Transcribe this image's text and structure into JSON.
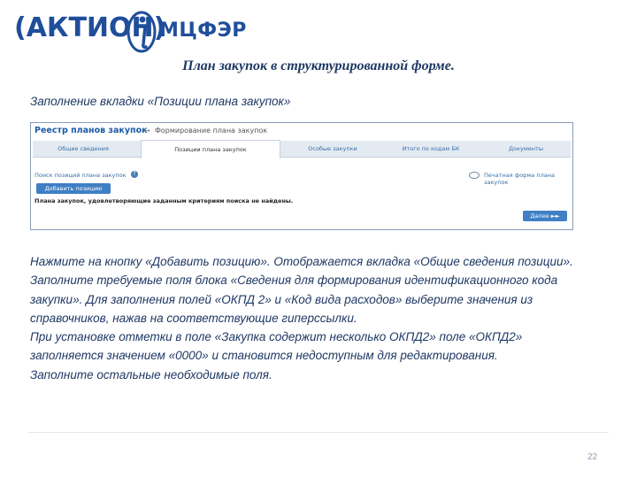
{
  "header": {
    "logo_left": "(АКТИОН)",
    "logo_right": "МЦФЭР",
    "colors": {
      "brand_blue": "#1f4e9b",
      "title_blue": "#1f3864"
    }
  },
  "slide": {
    "title": "План закупок в структурированной форме.",
    "subtitle": "Заполнение вкладки «Позиции плана закупок»"
  },
  "screenshot": {
    "breadcrumb_main": "Реестр планов закупок",
    "breadcrumb_arrow": "→",
    "breadcrumb_current": "Формирование плана закупок",
    "tabs": [
      {
        "label": "Общие сведения",
        "active": false
      },
      {
        "label": "Позиции плана закупок",
        "active": true
      },
      {
        "label": "Особые закупки",
        "active": false
      },
      {
        "label": "Итого по кодам БК",
        "active": false
      },
      {
        "label": "Документы",
        "active": false
      }
    ],
    "search_link": "Поиск позиций плана закупок",
    "print_link": "Печатная форма плана закупок",
    "add_button": "Добавить позицию",
    "notice": "Плана закупок, удовлетворяющие заданным критериям поиска не найдены.",
    "next_button": "Далее ►►"
  },
  "body": {
    "paragraphs": [
      "Нажмите на кнопку «Добавить позицию». Отображается вкладка «Общие сведения позиции». Заполните требуемые поля блока «Сведения для формирования идентификационного кода закупки». Для заполнения полей «ОКПД 2» и «Код вида расходов» выберите значения из справочников, нажав на соответствующие гиперссылки.",
      "При установке отметки в поле «Закупка содержит несколько ОКПД2» поле «ОКПД2» заполняется значением «0000» и становится недоступным для редактирования.",
      "Заполните  остальные необходимые поля."
    ]
  },
  "footer": {
    "page_number": "22"
  }
}
